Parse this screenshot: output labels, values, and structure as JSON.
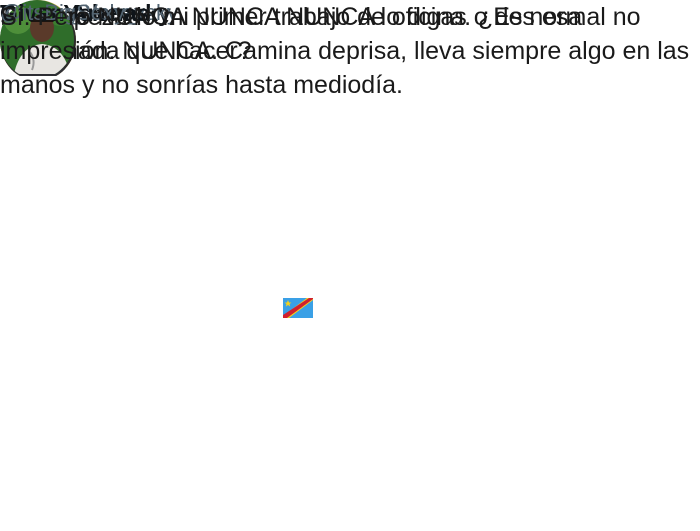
{
  "tweets": [
    {
      "display_name": "Tripp Yshevsky",
      "handle": "@Tripp_Yshevsky",
      "text": "He empezado mi primer trabajo de oficina. ¿Es normal no tener nada que hacer?"
    },
    {
      "display_name": "Given Arenas",
      "handle": "@itsBigSexy_",
      "flag": "dr-congo-flag-icon",
      "text": "Sí. Pero NUNCA NUNCA NUNCA lo digas o des esa impresión. NUNCA. Camina deprisa, lleva siempre algo en las manos y no sonrías hasta mediodía."
    }
  ]
}
